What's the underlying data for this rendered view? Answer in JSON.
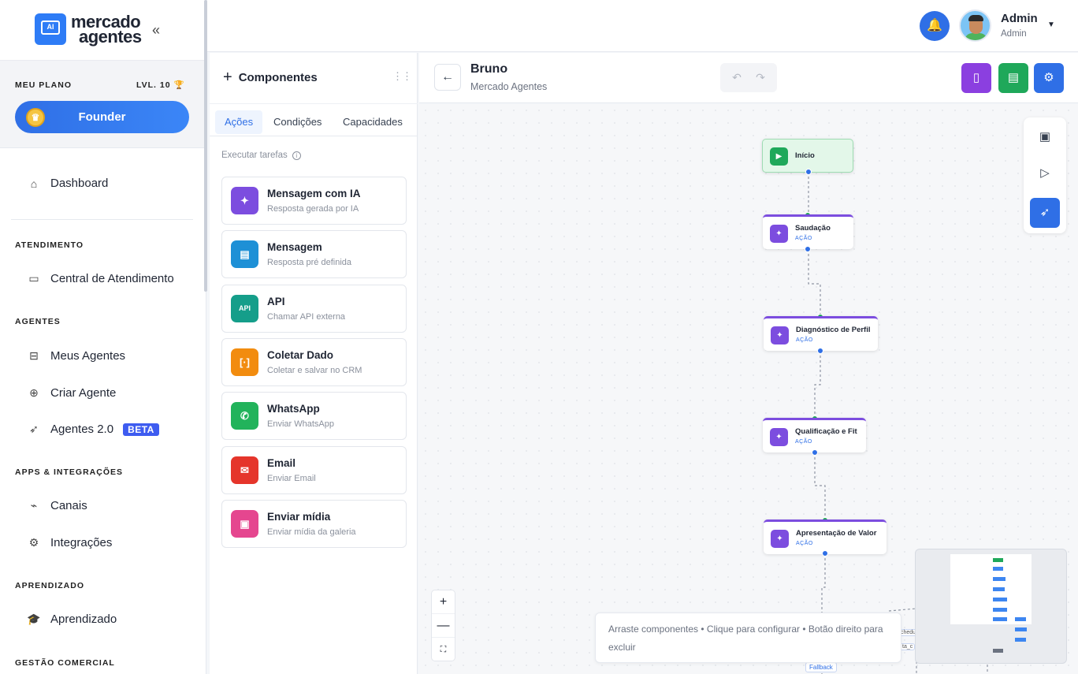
{
  "brand": {
    "line1": "mercado",
    "line2": "agentes",
    "logo_text": "AI"
  },
  "plan": {
    "label": "MEU PLANO",
    "level": "LVL. 10",
    "tier": "Founder"
  },
  "nav": {
    "dashboard": "Dashboard",
    "sections": {
      "atendimento": "ATENDIMENTO",
      "agentes": "AGENTES",
      "apps": "APPS & INTEGRAÇÕES",
      "aprendizado": "APRENDIZADO",
      "gestao": "GESTÃO COMERCIAL"
    },
    "central": "Central de Atendimento",
    "meus_agentes": "Meus Agentes",
    "criar_agente": "Criar Agente",
    "agentes2": "Agentes 2.0",
    "beta": "BETA",
    "canais": "Canais",
    "integracoes": "Integrações",
    "aprendizado": "Aprendizado"
  },
  "user": {
    "name": "Admin",
    "role": "Admin"
  },
  "components": {
    "title": "Componentes",
    "tabs": [
      "Ações",
      "Condições",
      "Capacidades"
    ],
    "subtitle": "Executar tarefas",
    "cards": [
      {
        "title": "Mensagem com IA",
        "desc": "Resposta gerada por IA",
        "color": "#7c4ddf"
      },
      {
        "title": "Mensagem",
        "desc": "Resposta pré definida",
        "color": "#1e90d6"
      },
      {
        "title": "API",
        "desc": "Chamar API externa",
        "color": "#159e8a"
      },
      {
        "title": "Coletar Dado",
        "desc": "Coletar e salvar no CRM",
        "color": "#f28c0f"
      },
      {
        "title": "WhatsApp",
        "desc": "Enviar WhatsApp",
        "color": "#22b35b"
      },
      {
        "title": "Email",
        "desc": "Enviar Email",
        "color": "#e5352b"
      },
      {
        "title": "Enviar mídia",
        "desc": "Enviar mídia da galeria",
        "color": "#e5468f"
      }
    ],
    "api_icon_text": "API"
  },
  "agent": {
    "name": "Bruno",
    "subtitle": "Mercado Agentes"
  },
  "header_buttons": {
    "book_color": "#8b3fe0",
    "doc_color": "#1fa85a",
    "settings_color": "#2f6fe6"
  },
  "flow": {
    "nodes": [
      {
        "title": "Início",
        "sub": ""
      },
      {
        "title": "Saudação",
        "sub": "AÇÃO"
      },
      {
        "title": "Diagnóstico de Perfil",
        "sub": "AÇÃO"
      },
      {
        "title": "Qualificação e Fit",
        "sub": "AÇÃO"
      },
      {
        "title": "Apresentação de Valor",
        "sub": "AÇÃO"
      }
    ],
    "fallback": "Fallback",
    "edge_label_1": "chedu",
    "edge_label_2": "ta_c"
  },
  "hint": "Arraste componentes • Clique para configurar • Botão direito para excluir"
}
